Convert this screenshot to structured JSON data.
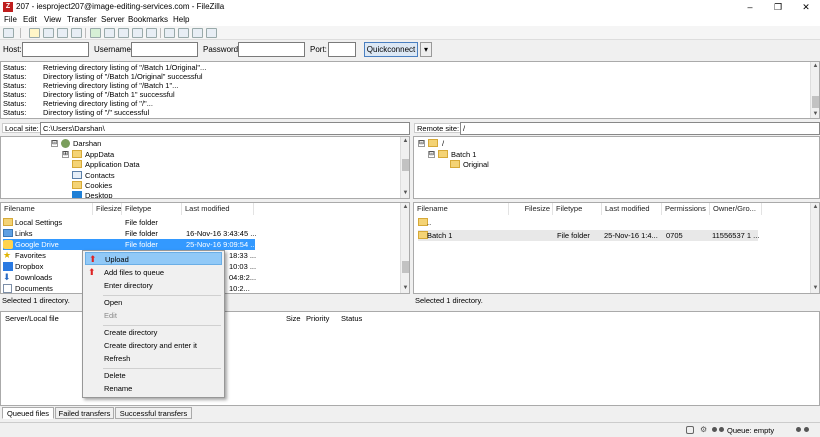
{
  "window": {
    "title": "207 - iesproject207@image-editing-services.com - FileZilla",
    "app_icon": "filezilla-icon"
  },
  "menu": [
    "File",
    "Edit",
    "View",
    "Transfer",
    "Server",
    "Bookmarks",
    "Help"
  ],
  "quickconnect": {
    "host_label": "Host:",
    "username_label": "Username:",
    "password_label": "Password:",
    "port_label": "Port:",
    "host_value": "",
    "username_value": "",
    "password_value": "",
    "port_value": "",
    "button_label": "Quickconnect",
    "dropdown_symbol": "▾"
  },
  "log": [
    {
      "status": "Status:",
      "message": "Retrieving directory listing of \"/Batch 1/Original\"..."
    },
    {
      "status": "Status:",
      "message": "Directory listing of \"/Batch 1/Original\" successful"
    },
    {
      "status": "Status:",
      "message": "Retrieving directory listing of \"/Batch 1\"..."
    },
    {
      "status": "Status:",
      "message": "Directory listing of \"/Batch 1\" successful"
    },
    {
      "status": "Status:",
      "message": "Retrieving directory listing of \"/\"..."
    },
    {
      "status": "Status:",
      "message": "Directory listing of \"/\" successful"
    }
  ],
  "local": {
    "site_label": "Local site:",
    "site_path": "C:\\Users\\Darshan\\",
    "tree": [
      {
        "label": "Darshan",
        "expander": "⊟",
        "icon": "user-icon"
      },
      {
        "label": "AppData",
        "expander": "⊞",
        "icon": "folder-icon"
      },
      {
        "label": "Application Data",
        "expander": "",
        "icon": "folder-icon"
      },
      {
        "label": "Contacts",
        "expander": "",
        "icon": "contacts-icon"
      },
      {
        "label": "Cookies",
        "expander": "",
        "icon": "folder-icon"
      },
      {
        "label": "Desktop",
        "expander": "",
        "icon": "desktop-icon"
      }
    ],
    "columns": [
      "Filename",
      "Filesize",
      "Filetype",
      "Last modified"
    ],
    "files": [
      {
        "name": "Local Settings",
        "size": "",
        "type": "File folder",
        "modified": ""
      },
      {
        "name": "Links",
        "size": "",
        "type": "File folder",
        "modified": "16-Nov-16 3:43:45 ..."
      },
      {
        "name": "Google Drive",
        "size": "",
        "type": "File folder",
        "modified": "25-Nov-16 9:09:54 ..."
      },
      {
        "name": "Favorites",
        "size": "",
        "type": "",
        "modified": "18:33 ..."
      },
      {
        "name": "Dropbox",
        "size": "",
        "type": "",
        "modified": "10:03 ..."
      },
      {
        "name": "Downloads",
        "size": "",
        "type": "",
        "modified": "04:8:2..."
      },
      {
        "name": "Documents",
        "size": "",
        "type": "",
        "modified": "10:2..."
      }
    ],
    "status": "Selected 1 directory."
  },
  "remote": {
    "site_label": "Remote site:",
    "site_path": "/",
    "tree": [
      {
        "label": "/",
        "expander": "⊟"
      },
      {
        "label": "Batch 1",
        "expander": "⊟"
      },
      {
        "label": "Original",
        "expander": ""
      }
    ],
    "columns": [
      "Filename",
      "Filesize",
      "Filetype",
      "Last modified",
      "Permissions",
      "Owner/Gro..."
    ],
    "files": [
      {
        "name": "..",
        "size": "",
        "type": "",
        "modified": "",
        "perms": "",
        "owner": ""
      },
      {
        "name": "Batch 1",
        "size": "",
        "type": "File folder",
        "modified": "25-Nov-16 1:4...",
        "perms": "0705",
        "owner": "11556537 1 ..."
      }
    ],
    "status": "Selected 1 directory."
  },
  "queue": {
    "columns": [
      "Server/Local file",
      "Size",
      "Priority",
      "Status"
    ],
    "tabs": [
      "Queued files",
      "Failed transfers",
      "Successful transfers"
    ],
    "status": "Queue: empty"
  },
  "context_menu": [
    {
      "label": "Upload",
      "icon": "upload-icon",
      "highlighted": true
    },
    {
      "label": "Add files to queue",
      "icon": "add-queue-icon"
    },
    {
      "label": "Enter directory"
    },
    {
      "sep": true
    },
    {
      "label": "Open"
    },
    {
      "label": "Edit",
      "disabled": true
    },
    {
      "sep": true
    },
    {
      "label": "Create directory"
    },
    {
      "label": "Create directory and enter it"
    },
    {
      "label": "Refresh"
    },
    {
      "sep": true
    },
    {
      "label": "Delete"
    },
    {
      "label": "Rename"
    }
  ],
  "colors": {
    "selection": "#3399ff",
    "menu_highlight": "#91c9f7",
    "folder": "#f4d375"
  }
}
